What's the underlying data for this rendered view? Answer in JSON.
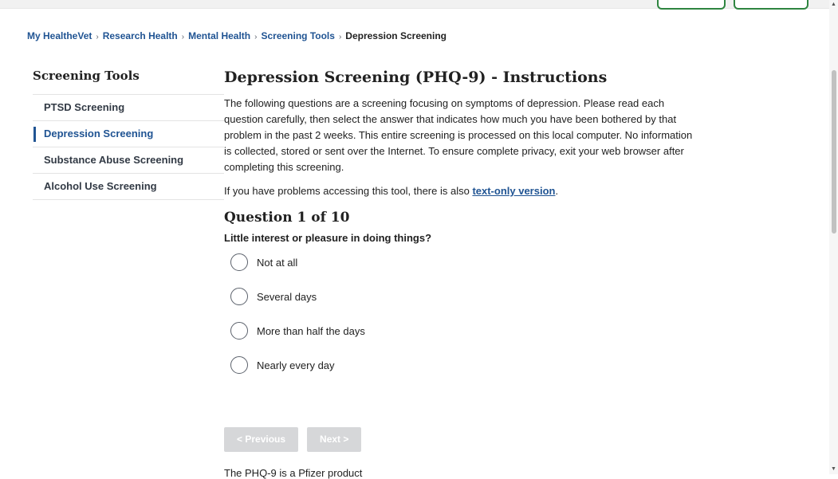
{
  "breadcrumb": {
    "items": [
      "My HealtheVet",
      "Research Health",
      "Mental Health",
      "Screening Tools"
    ],
    "current": "Depression Screening",
    "separator": "›"
  },
  "sidebar": {
    "title": "Screening Tools",
    "items": [
      {
        "label": "PTSD Screening"
      },
      {
        "label": "Depression Screening"
      },
      {
        "label": "Substance Abuse Screening"
      },
      {
        "label": "Alcohol Use Screening"
      }
    ]
  },
  "main": {
    "title": "Depression Screening (PHQ-9) - Instructions",
    "intro_lines": [
      "The following questions are a screening focusing on symptoms of depression. Please read each",
      "question carefully, then select the answer that indicates how much you have been bothered by",
      "that problem in the past 2 weeks. This entire screening is processed on this local computer. No",
      "information is collected, stored or sent over the Internet. To ensure complete privacy, exit your",
      "web browser after completing this screening."
    ],
    "access_text": "If you have problems accessing this tool, there is also ",
    "access_link": "text-only version",
    "access_end": ".",
    "question_heading": "Question 1 of 10",
    "question_text": "Little interest or pleasure in doing things?",
    "options": [
      "Not at all",
      "Several days",
      "More than half the days",
      "Nearly every day"
    ],
    "prev_label": "< Previous",
    "next_label": "Next >",
    "footer_note": "The PHQ-9 is a Pfizer product"
  },
  "colors": {
    "link": "#205493",
    "button_disabled": "#d6d7d9",
    "top_button_border": "#2e8540"
  }
}
